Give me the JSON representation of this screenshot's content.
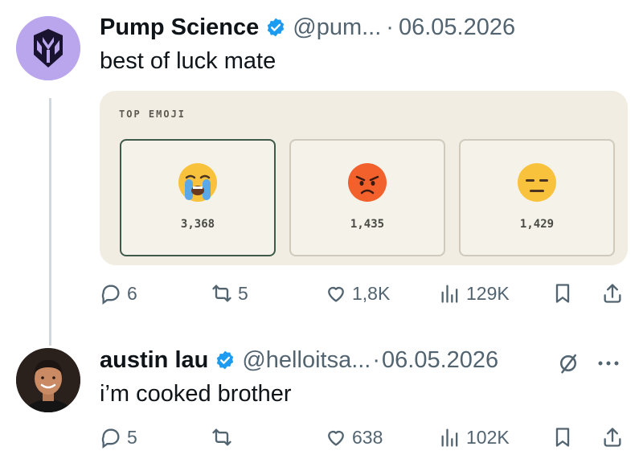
{
  "tweets": [
    {
      "author": "Pump Science",
      "handle": "@pum...",
      "sep": "·",
      "date": "06.05.2026",
      "text": "best of luck mate",
      "card": {
        "title": "TOP EMOJI",
        "emojis": [
          {
            "icon": "loudly-crying-face-icon",
            "count": "3,368"
          },
          {
            "icon": "angry-face-icon",
            "count": "1,435"
          },
          {
            "icon": "expressionless-face-icon",
            "count": "1,429"
          }
        ]
      },
      "actions": {
        "replies": "6",
        "reposts": "5",
        "likes": "1,8K",
        "views": "129K"
      }
    },
    {
      "author": "austin lau",
      "handle": "@helloitsa...",
      "sep": "·",
      "date": "06.05.2026",
      "text": "i’m cooked brother",
      "actions": {
        "replies": "5",
        "reposts": "",
        "likes": "638",
        "views": "102K"
      }
    }
  ],
  "colors": {
    "verified": "#1d9bf0",
    "muted": "#536471",
    "card_bg": "#f1ede3",
    "avatar1_bg": "#b9a6ec"
  }
}
